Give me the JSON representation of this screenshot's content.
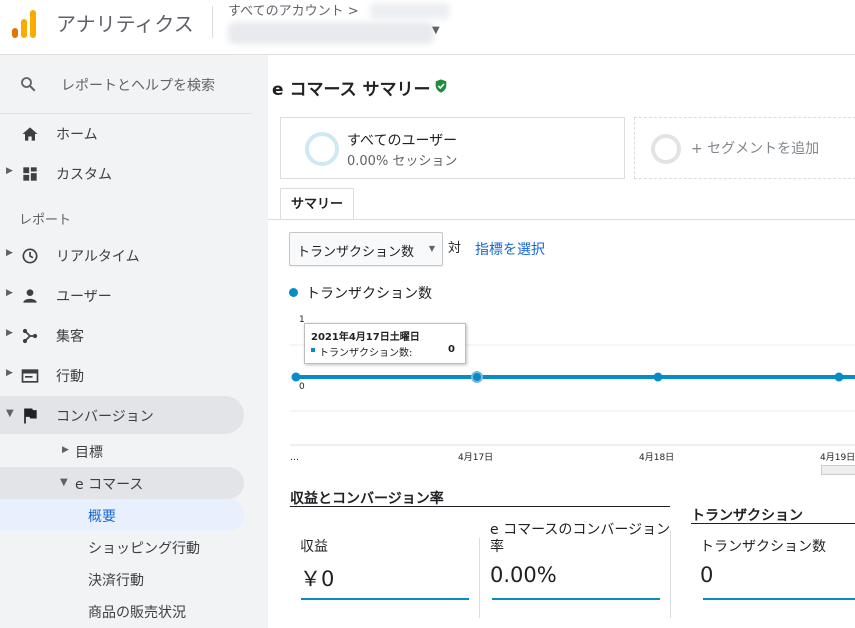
{
  "header": {
    "app_title": "アナリティクス",
    "account_path": "すべてのアカウント >"
  },
  "sidebar": {
    "search_placeholder": "レポートとヘルプを検索",
    "home": "ホーム",
    "custom": "カスタム",
    "section_reports": "レポート",
    "realtime": "リアルタイム",
    "users": "ユーザー",
    "acquisition": "集客",
    "behavior": "行動",
    "conversions": "コンバージョン",
    "goals": "目標",
    "ecommerce": "e コマース",
    "overview": "概要",
    "shopping_behavior": "ショッピング行動",
    "checkout_behavior": "決済行動",
    "product_performance": "商品の販売状況"
  },
  "main": {
    "title": "e コマース サマリー",
    "segment": {
      "name": "すべてのユーザー",
      "sub": "0.00% セッション"
    },
    "add_segment": "+ セグメントを追加",
    "tab_summary": "サマリー",
    "metric_select": "トランザクション数",
    "vs": "対",
    "pick_metric": "指標を選択",
    "legend": "トランザクション数"
  },
  "chart_data": {
    "type": "line",
    "series": [
      {
        "name": "トランザクション数",
        "values": [
          0,
          0,
          0,
          0
        ]
      }
    ],
    "x": [
      "…",
      "4月17日",
      "4月18日",
      "4月19日"
    ],
    "y_ticks": [
      "1",
      "0"
    ],
    "ylim": [
      0,
      1
    ],
    "color": "#058dc7",
    "tooltip": {
      "date": "2021年4月17日土曜日",
      "key": "トランザクション数:",
      "value": "0"
    }
  },
  "kpis": {
    "revenue_heading": "収益とコンバージョン率",
    "transactions_heading": "トランザクション",
    "revenue_label": "収益",
    "revenue_value": "￥0",
    "conv_label_1": "e コマースのコンバージョン",
    "conv_label_2": "率",
    "conv_value": "0.00%",
    "tx_label": "トランザクション数",
    "tx_value": "0"
  },
  "colors": {
    "accent": "#058dc7",
    "link": "#1967d2",
    "sidebar_bg": "#f1f3f4",
    "verified": "#1e8e3e"
  }
}
